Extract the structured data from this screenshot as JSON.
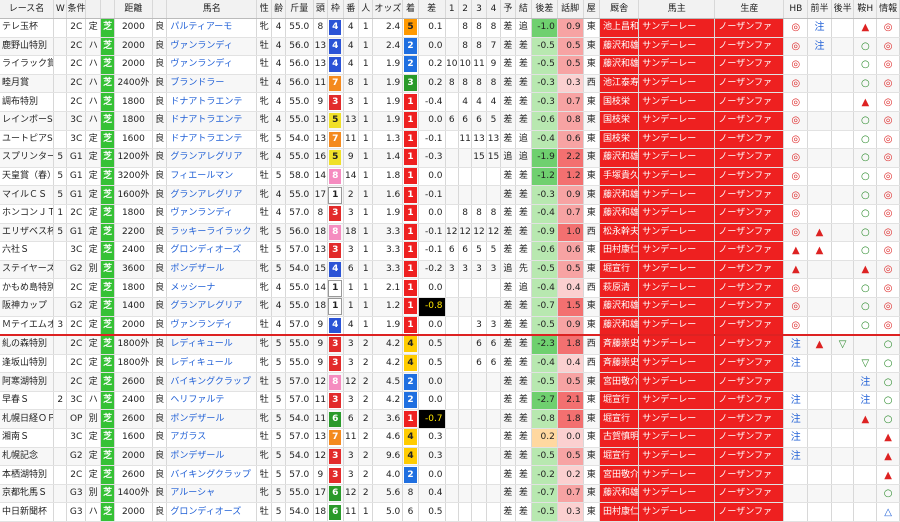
{
  "colors": {
    "waku": {
      "1": "#ffffff",
      "2": "#222222",
      "3": "#e22b2b",
      "4": "#2b53d6",
      "5": "#f0e028",
      "6": "#2a9a2a",
      "7": "#f48a1e",
      "8": "#f58cc0"
    },
    "finish": {
      "1": "#ee2020",
      "2": "#1f6fe0",
      "3": "#2a9a2a",
      "4": "#ffcc00",
      "5": "#ff9900"
    },
    "grass": "#35c135",
    "link": "#1f5fd6",
    "owner_bg": "#ee2020",
    "divider": "#d22222"
  },
  "headers": [
    "レース名",
    "W",
    "条件",
    "",
    "",
    "距離",
    "",
    "馬名",
    "性",
    "齢",
    "斤量",
    "頭",
    "枠",
    "番",
    "人",
    "オッズ",
    "着",
    "差",
    "1",
    "2",
    "3",
    "4",
    "予",
    "結",
    "後差",
    "話脚",
    "屋",
    "厩舎",
    "馬主",
    "生産",
    "HB",
    "前半",
    "後半",
    "鞍H",
    "情報"
  ],
  "rows": [
    {
      "race": "テレ玉杯",
      "w": "",
      "cls": "2C",
      "cond": "定",
      "surf": "芝",
      "dist": "2000",
      "gd": "良",
      "horse": "パルティアーモ",
      "sex": "牝",
      "age": "4",
      "kg": "55.0",
      "n": "8",
      "waku": "4",
      "ban": "4",
      "pop": "1",
      "odds": "2.4",
      "fin": "5",
      "diff": "0.1",
      "p1": "",
      "p2": "8",
      "p3": "8",
      "p4": "8",
      "pred": "差",
      "res": "追",
      "ato": "-1.0",
      "wa": "0.9",
      "loc": "東",
      "trainer": "池上昌和",
      "owner": "サンデーレー",
      "breeder": "ノーザンファ",
      "hb": "◎",
      "zen": "注",
      "kou": "",
      "kura": "▲",
      "info": "◎"
    },
    {
      "race": "鹿野山特別",
      "w": "",
      "cls": "2C",
      "cond": "ハ",
      "surf": "芝",
      "dist": "2000",
      "gd": "良",
      "horse": "ヴァンランディ",
      "sex": "牡",
      "age": "4",
      "kg": "56.0",
      "n": "13",
      "waku": "4",
      "ban": "4",
      "pop": "1",
      "odds": "2.4",
      "fin": "2",
      "diff": "0.0",
      "p1": "",
      "p2": "8",
      "p3": "8",
      "p4": "7",
      "pred": "差",
      "res": "差",
      "ato": "-0.5",
      "wa": "0.5",
      "loc": "東",
      "trainer": "藤沢和雄",
      "owner": "サンデーレー",
      "breeder": "ノーザンファ",
      "hb": "◎",
      "zen": "注",
      "kou": "",
      "kura": "○",
      "info": "◎"
    },
    {
      "race": "ライラック賞",
      "w": "",
      "cls": "2C",
      "cond": "ハ",
      "surf": "芝",
      "dist": "2000",
      "gd": "良",
      "horse": "ヴァンランディ",
      "sex": "牡",
      "age": "4",
      "kg": "56.0",
      "n": "13",
      "waku": "4",
      "ban": "4",
      "pop": "1",
      "odds": "1.9",
      "fin": "2",
      "diff": "0.2",
      "p1": "10",
      "p2": "10",
      "p3": "11",
      "p4": "9",
      "pred": "差",
      "res": "差",
      "ato": "-0.5",
      "wa": "0.5",
      "loc": "東",
      "trainer": "藤沢和雄",
      "owner": "サンデーレー",
      "breeder": "ノーザンファ",
      "hb": "◎",
      "zen": "",
      "kou": "",
      "kura": "○",
      "info": "◎"
    },
    {
      "race": "睦月賞",
      "w": "",
      "cls": "2C",
      "cond": "ハ",
      "surf": "芝",
      "dist": "2400外",
      "gd": "良",
      "horse": "ブランドラー",
      "sex": "牡",
      "age": "4",
      "kg": "56.0",
      "n": "11",
      "waku": "7",
      "ban": "8",
      "pop": "1",
      "odds": "1.9",
      "fin": "3",
      "diff": "0.2",
      "p1": "8",
      "p2": "8",
      "p3": "8",
      "p4": "8",
      "pred": "差",
      "res": "差",
      "ato": "-0.3",
      "wa": "0.3",
      "loc": "西",
      "trainer": "池江泰寿",
      "owner": "サンデーレー",
      "breeder": "ノーザンファ",
      "hb": "◎",
      "zen": "",
      "kou": "",
      "kura": "○",
      "info": "◎"
    },
    {
      "race": "調布特別",
      "w": "",
      "cls": "2C",
      "cond": "ハ",
      "surf": "芝",
      "dist": "1800",
      "gd": "良",
      "horse": "ドナアトラエンテ",
      "sex": "牝",
      "age": "4",
      "kg": "55.0",
      "n": "9",
      "waku": "3",
      "ban": "3",
      "pop": "1",
      "odds": "1.9",
      "fin": "1",
      "diff": "-0.4",
      "p1": "",
      "p2": "4",
      "p3": "4",
      "p4": "4",
      "pred": "差",
      "res": "差",
      "ato": "-0.3",
      "wa": "0.7",
      "loc": "東",
      "trainer": "国枝栄",
      "owner": "サンデーレー",
      "breeder": "ノーザンファ",
      "hb": "◎",
      "zen": "",
      "kou": "",
      "kura": "▲",
      "info": "◎"
    },
    {
      "race": "レインボーS",
      "w": "",
      "cls": "3C",
      "cond": "ハ",
      "surf": "芝",
      "dist": "1800",
      "gd": "良",
      "horse": "ドナアトラエンテ",
      "sex": "牝",
      "age": "4",
      "kg": "55.0",
      "n": "13",
      "waku": "5",
      "ban": "13",
      "pop": "1",
      "odds": "1.9",
      "fin": "1",
      "diff": "0.0",
      "p1": "6",
      "p2": "6",
      "p3": "6",
      "p4": "5",
      "pred": "差",
      "res": "差",
      "ato": "-0.6",
      "wa": "0.8",
      "loc": "東",
      "trainer": "国枝栄",
      "owner": "サンデーレー",
      "breeder": "ノーザンファ",
      "hb": "◎",
      "zen": "",
      "kou": "",
      "kura": "○",
      "info": "◎"
    },
    {
      "race": "ユートピアS",
      "w": "",
      "cls": "3C",
      "cond": "定",
      "surf": "芝",
      "dist": "1600",
      "gd": "良",
      "horse": "ドナアトラエンテ",
      "sex": "牝",
      "age": "5",
      "kg": "54.0",
      "n": "13",
      "waku": "7",
      "ban": "11",
      "pop": "1",
      "odds": "1.3",
      "fin": "1",
      "diff": "-0.1",
      "p1": "",
      "p2": "11",
      "p3": "13",
      "p4": "13",
      "pred": "差",
      "res": "追",
      "ato": "-0.4",
      "wa": "0.6",
      "loc": "東",
      "trainer": "国枝栄",
      "owner": "サンデーレー",
      "breeder": "ノーザンファ",
      "hb": "◎",
      "zen": "",
      "kou": "",
      "kura": "○",
      "info": "◎"
    },
    {
      "race": "スプリンター",
      "w": "5",
      "cls": "G1",
      "cond": "定",
      "surf": "芝",
      "dist": "1200外",
      "gd": "良",
      "horse": "グランアレグリア",
      "sex": "牝",
      "age": "4",
      "kg": "55.0",
      "n": "16",
      "waku": "5",
      "ban": "9",
      "pop": "1",
      "odds": "1.4",
      "fin": "1",
      "diff": "-0.3",
      "p1": "",
      "p2": "",
      "p3": "15",
      "p4": "15",
      "pred": "追",
      "res": "追",
      "ato": "-1.9",
      "wa": "2.2",
      "loc": "東",
      "trainer": "藤沢和雄",
      "owner": "サンデーレー",
      "breeder": "ノーザンファ",
      "hb": "◎",
      "zen": "",
      "kou": "",
      "kura": "○",
      "info": "◎"
    },
    {
      "race": "天皇賞（春）",
      "w": "5",
      "cls": "G1",
      "cond": "定",
      "surf": "芝",
      "dist": "3200外",
      "gd": "良",
      "horse": "フィエールマン",
      "sex": "牡",
      "age": "5",
      "kg": "58.0",
      "n": "14",
      "waku": "8",
      "ban": "14",
      "pop": "1",
      "odds": "1.8",
      "fin": "1",
      "diff": "0.0",
      "p1": "",
      "p2": "",
      "p3": "",
      "p4": "",
      "pred": "差",
      "res": "差",
      "ato": "-1.2",
      "wa": "1.2",
      "loc": "東",
      "trainer": "手塚貴久",
      "owner": "サンデーレー",
      "breeder": "ノーザンファ",
      "hb": "◎",
      "zen": "",
      "kou": "",
      "kura": "○",
      "info": "◎"
    },
    {
      "race": "マイルＣＳ",
      "w": "5",
      "cls": "G1",
      "cond": "定",
      "surf": "芝",
      "dist": "1600外",
      "gd": "良",
      "horse": "グランアレグリア",
      "sex": "牝",
      "age": "4",
      "kg": "55.0",
      "n": "17",
      "waku": "1",
      "ban": "2",
      "pop": "1",
      "odds": "1.6",
      "fin": "1",
      "diff": "-0.1",
      "p1": "",
      "p2": "",
      "p3": "",
      "p4": "",
      "pred": "差",
      "res": "差",
      "ato": "-0.3",
      "wa": "0.9",
      "loc": "東",
      "trainer": "藤沢和雄",
      "owner": "サンデーレー",
      "breeder": "ノーザンファ",
      "hb": "◎",
      "zen": "",
      "kou": "",
      "kura": "○",
      "info": "◎"
    },
    {
      "race": "ホンコンＪＴ",
      "w": "1",
      "cls": "2C",
      "cond": "定",
      "surf": "芝",
      "dist": "1800",
      "gd": "良",
      "horse": "ヴァンランディ",
      "sex": "牡",
      "age": "4",
      "kg": "57.0",
      "n": "8",
      "waku": "3",
      "ban": "3",
      "pop": "1",
      "odds": "1.9",
      "fin": "1",
      "diff": "0.0",
      "p1": "",
      "p2": "8",
      "p3": "8",
      "p4": "8",
      "pred": "差",
      "res": "差",
      "ato": "-0.4",
      "wa": "0.7",
      "loc": "東",
      "trainer": "藤沢和雄",
      "owner": "サンデーレー",
      "breeder": "ノーザンファ",
      "hb": "◎",
      "zen": "",
      "kou": "",
      "kura": "○",
      "info": "◎"
    },
    {
      "race": "エリザベス杯",
      "w": "5",
      "cls": "G1",
      "cond": "定",
      "surf": "芝",
      "dist": "2200",
      "gd": "良",
      "horse": "ラッキーライラック",
      "sex": "牝",
      "age": "5",
      "kg": "56.0",
      "n": "18",
      "waku": "8",
      "ban": "18",
      "pop": "1",
      "odds": "3.3",
      "fin": "1",
      "diff": "-0.1",
      "p1": "12",
      "p2": "12",
      "p3": "12",
      "p4": "12",
      "pred": "差",
      "res": "差",
      "ato": "-0.9",
      "wa": "1.0",
      "loc": "西",
      "trainer": "松永幹夫",
      "owner": "サンデーレー",
      "breeder": "ノーザンファ",
      "hb": "◎",
      "zen": "▲",
      "kou": "",
      "kura": "○",
      "info": "◎"
    },
    {
      "race": "六社Ｓ",
      "w": "",
      "cls": "3C",
      "cond": "定",
      "surf": "芝",
      "dist": "2400",
      "gd": "良",
      "horse": "グロンディオーズ",
      "sex": "牡",
      "age": "5",
      "kg": "57.0",
      "n": "13",
      "waku": "3",
      "ban": "3",
      "pop": "1",
      "odds": "3.3",
      "fin": "1",
      "diff": "-0.1",
      "p1": "6",
      "p2": "6",
      "p3": "5",
      "p4": "5",
      "pred": "差",
      "res": "差",
      "ato": "-0.6",
      "wa": "0.6",
      "loc": "東",
      "trainer": "田村康仁",
      "owner": "サンデーレー",
      "breeder": "ノーザンファ",
      "hb": "▲",
      "zen": "▲",
      "kou": "",
      "kura": "○",
      "info": "◎"
    },
    {
      "race": "ステイヤーズ",
      "w": "",
      "cls": "G2",
      "cond": "別",
      "surf": "芝",
      "dist": "3600",
      "gd": "良",
      "horse": "ポンデザール",
      "sex": "牝",
      "age": "5",
      "kg": "54.0",
      "n": "15",
      "waku": "4",
      "ban": "6",
      "pop": "1",
      "odds": "3.3",
      "fin": "1",
      "diff": "-0.2",
      "p1": "3",
      "p2": "3",
      "p3": "3",
      "p4": "3",
      "pred": "追",
      "res": "先",
      "ato": "-0.5",
      "wa": "0.5",
      "loc": "東",
      "trainer": "堀宣行",
      "owner": "サンデーレー",
      "breeder": "ノーザンファ",
      "hb": "▲",
      "zen": "",
      "kou": "",
      "kura": "▲",
      "info": "◎"
    },
    {
      "race": "かもめ島特別",
      "w": "",
      "cls": "2C",
      "cond": "定",
      "surf": "芝",
      "dist": "1800",
      "gd": "良",
      "horse": "メッシーナ",
      "sex": "牝",
      "age": "4",
      "kg": "55.0",
      "n": "14",
      "waku": "1",
      "ban": "1",
      "pop": "1",
      "odds": "2.1",
      "fin": "1",
      "diff": "0.0",
      "p1": "",
      "p2": "",
      "p3": "",
      "p4": "",
      "pred": "差",
      "res": "追",
      "ato": "-0.4",
      "wa": "0.4",
      "loc": "西",
      "trainer": "萩原清",
      "owner": "サンデーレー",
      "breeder": "ノーザンファ",
      "hb": "◎",
      "zen": "",
      "kou": "",
      "kura": "○",
      "info": "◎"
    },
    {
      "race": "阪神カップ",
      "w": "",
      "cls": "G2",
      "cond": "定",
      "surf": "芝",
      "dist": "1400",
      "gd": "良",
      "horse": "グランアレグリア",
      "sex": "牝",
      "age": "4",
      "kg": "55.0",
      "n": "18",
      "waku": "1",
      "ban": "1",
      "pop": "1",
      "odds": "1.2",
      "fin": "1",
      "diff": "-0.8",
      "p1": "",
      "p2": "",
      "p3": "",
      "p4": "",
      "pred": "差",
      "res": "差",
      "ato": "-0.7",
      "wa": "1.5",
      "loc": "東",
      "trainer": "藤沢和雄",
      "owner": "サンデーレー",
      "breeder": "ノーザンファ",
      "hb": "◎",
      "zen": "",
      "kou": "",
      "kura": "○",
      "info": "◎"
    },
    {
      "race": "Ｍテイエムオ",
      "w": "3",
      "cls": "2C",
      "cond": "定",
      "surf": "芝",
      "dist": "2000",
      "gd": "良",
      "horse": "ヴァンランディ",
      "sex": "牡",
      "age": "4",
      "kg": "57.0",
      "n": "9",
      "waku": "4",
      "ban": "4",
      "pop": "1",
      "odds": "1.9",
      "fin": "1",
      "diff": "0.0",
      "p1": "",
      "p2": "",
      "p3": "3",
      "p4": "3",
      "pred": "差",
      "res": "差",
      "ato": "-0.5",
      "wa": "0.9",
      "loc": "東",
      "trainer": "藤沢和雄",
      "owner": "サンデーレー",
      "breeder": "ノーザンファ",
      "hb": "◎",
      "zen": "",
      "kou": "",
      "kura": "○",
      "info": "◎"
    },
    {
      "race": "糺の森特別",
      "w": "",
      "cls": "2C",
      "cond": "定",
      "surf": "芝",
      "dist": "1800外",
      "gd": "良",
      "horse": "レディキュール",
      "sex": "牝",
      "age": "5",
      "kg": "55.0",
      "n": "9",
      "waku": "3",
      "ban": "3",
      "pop": "2",
      "odds": "4.2",
      "fin": "4",
      "diff": "0.5",
      "p1": "",
      "p2": "",
      "p3": "6",
      "p4": "6",
      "pred": "差",
      "res": "差",
      "ato": "-2.3",
      "wa": "1.8",
      "loc": "西",
      "trainer": "斉藤崇史",
      "owner": "サンデーレー",
      "breeder": "ノーザンファ",
      "hb": "注",
      "zen": "▲",
      "kou": "▽",
      "info": "○"
    },
    {
      "race": "逢坂山特別",
      "w": "",
      "cls": "2C",
      "cond": "定",
      "surf": "芝",
      "dist": "1800外",
      "gd": "良",
      "horse": "レディキュール",
      "sex": "牝",
      "age": "5",
      "kg": "55.0",
      "n": "9",
      "waku": "3",
      "ban": "3",
      "pop": "2",
      "odds": "4.2",
      "fin": "4",
      "diff": "0.5",
      "p1": "",
      "p2": "",
      "p3": "6",
      "p4": "6",
      "pred": "差",
      "res": "差",
      "ato": "-0.4",
      "wa": "0.4",
      "loc": "西",
      "trainer": "斉藤崇史",
      "owner": "サンデーレー",
      "breeder": "ノーザンファ",
      "hb": "注",
      "zen": "",
      "kou": "",
      "kura": "▽",
      "info": "○"
    },
    {
      "race": "阿寒湖特別",
      "w": "",
      "cls": "2C",
      "cond": "定",
      "surf": "芝",
      "dist": "2600",
      "gd": "良",
      "horse": "バイキングクラップ",
      "sex": "牡",
      "age": "5",
      "kg": "57.0",
      "n": "12",
      "waku": "8",
      "ban": "12",
      "pop": "2",
      "odds": "4.5",
      "fin": "2",
      "diff": "0.0",
      "p1": "",
      "p2": "",
      "p3": "",
      "p4": "",
      "pred": "差",
      "res": "差",
      "ato": "-0.5",
      "wa": "0.5",
      "loc": "東",
      "trainer": "宮田敬介",
      "owner": "サンデーレー",
      "breeder": "ノーザンファ",
      "hb": "",
      "zen": "",
      "kou": "",
      "kura": "注",
      "info": "○"
    },
    {
      "race": "早春Ｓ",
      "w": "2",
      "cls": "3C",
      "cond": "ハ",
      "surf": "芝",
      "dist": "2400",
      "gd": "良",
      "horse": "ヘリファルテ",
      "sex": "牡",
      "age": "5",
      "kg": "57.0",
      "n": "11",
      "waku": "3",
      "ban": "3",
      "pop": "2",
      "odds": "4.2",
      "fin": "2",
      "diff": "0.0",
      "p1": "",
      "p2": "",
      "p3": "",
      "p4": "",
      "pred": "差",
      "res": "差",
      "ato": "-2.7",
      "wa": "2.1",
      "loc": "東",
      "trainer": "堀宣行",
      "owner": "サンデーレー",
      "breeder": "ノーザンファ",
      "hb": "注",
      "zen": "",
      "kou": "",
      "kura": "注",
      "info": "○"
    },
    {
      "race": "札幌日経ＯＰ",
      "w": "",
      "cls": "OP",
      "cond": "別",
      "surf": "芝",
      "dist": "2600",
      "gd": "良",
      "horse": "ポンデザール",
      "sex": "牝",
      "age": "5",
      "kg": "54.0",
      "n": "11",
      "waku": "6",
      "ban": "6",
      "pop": "2",
      "odds": "3.6",
      "fin": "1",
      "diff": "-0.7",
      "p1": "",
      "p2": "",
      "p3": "",
      "p4": "",
      "pred": "差",
      "res": "差",
      "ato": "-0.8",
      "wa": "1.8",
      "loc": "東",
      "trainer": "堀宣行",
      "owner": "サンデーレー",
      "breeder": "ノーザンファ",
      "hb": "注",
      "zen": "",
      "kou": "",
      "kura": "▲",
      "info": "○"
    },
    {
      "race": "湘南Ｓ",
      "w": "",
      "cls": "3C",
      "cond": "定",
      "surf": "芝",
      "dist": "1600",
      "gd": "良",
      "horse": "アガラス",
      "sex": "牡",
      "age": "5",
      "kg": "57.0",
      "n": "13",
      "waku": "7",
      "ban": "11",
      "pop": "2",
      "odds": "4.6",
      "fin": "4",
      "diff": "0.3",
      "p1": "",
      "p2": "",
      "p3": "",
      "p4": "",
      "pred": "差",
      "res": "差",
      "ato": "0.2",
      "wa": "0.0",
      "loc": "東",
      "trainer": "古賀慎明",
      "owner": "サンデーレー",
      "breeder": "ノーザンファ",
      "hb": "注",
      "zen": "",
      "kou": "",
      "kura": "",
      "info": "▲"
    },
    {
      "race": "札幌記念",
      "w": "",
      "cls": "G2",
      "cond": "定",
      "surf": "芝",
      "dist": "2000",
      "gd": "良",
      "horse": "ポンデザール",
      "sex": "牝",
      "age": "5",
      "kg": "54.0",
      "n": "12",
      "waku": "3",
      "ban": "3",
      "pop": "2",
      "odds": "9.6",
      "fin": "4",
      "diff": "0.3",
      "p1": "",
      "p2": "",
      "p3": "",
      "p4": "",
      "pred": "差",
      "res": "差",
      "ato": "-0.5",
      "wa": "0.5",
      "loc": "東",
      "trainer": "堀宣行",
      "owner": "サンデーレー",
      "breeder": "ノーザンファ",
      "hb": "注",
      "zen": "",
      "kou": "",
      "kura": "",
      "info": "▲"
    },
    {
      "race": "本栖湖特別",
      "w": "",
      "cls": "2C",
      "cond": "定",
      "surf": "芝",
      "dist": "2600",
      "gd": "良",
      "horse": "バイキングクラップ",
      "sex": "牡",
      "age": "5",
      "kg": "57.0",
      "n": "9",
      "waku": "3",
      "ban": "3",
      "pop": "2",
      "odds": "4.0",
      "fin": "2",
      "diff": "0.0",
      "p1": "",
      "p2": "",
      "p3": "",
      "p4": "",
      "pred": "差",
      "res": "差",
      "ato": "-0.2",
      "wa": "0.2",
      "loc": "東",
      "trainer": "宮田敬介",
      "owner": "サンデーレー",
      "breeder": "ノーザンファ",
      "hb": "",
      "zen": "",
      "kou": "",
      "kura": "",
      "info": "▲"
    },
    {
      "race": "京都牝馬Ｓ",
      "w": "",
      "cls": "G3",
      "cond": "別",
      "surf": "芝",
      "dist": "1400外",
      "gd": "良",
      "horse": "アルーシャ",
      "sex": "牝",
      "age": "5",
      "kg": "55.0",
      "n": "17",
      "waku": "6",
      "ban": "12",
      "pop": "2",
      "odds": "5.6",
      "fin": "8",
      "diff": "0.4",
      "p1": "",
      "p2": "",
      "p3": "",
      "p4": "",
      "pred": "差",
      "res": "差",
      "ato": "-0.7",
      "wa": "0.7",
      "loc": "東",
      "trainer": "藤沢和雄",
      "owner": "サンデーレー",
      "breeder": "ノーザンファ",
      "hb": "",
      "zen": "",
      "kou": "",
      "kura": "",
      "info": "○"
    },
    {
      "race": "中日新聞杯",
      "w": "",
      "cls": "G3",
      "cond": "ハ",
      "surf": "芝",
      "dist": "2000",
      "gd": "良",
      "horse": "グロンディオーズ",
      "sex": "牡",
      "age": "5",
      "kg": "54.0",
      "n": "18",
      "waku": "6",
      "ban": "11",
      "pop": "1",
      "odds": "5.0",
      "fin": "6",
      "diff": "0.5",
      "p1": "",
      "p2": "",
      "p3": "",
      "p4": "",
      "pred": "差",
      "res": "差",
      "ato": "-0.5",
      "wa": "0.3",
      "loc": "東",
      "trainer": "田村康仁",
      "owner": "サンデーレー",
      "breeder": "ノーザンファ",
      "hb": "",
      "zen": "",
      "kou": "",
      "kura": "",
      "info": "△"
    }
  ]
}
